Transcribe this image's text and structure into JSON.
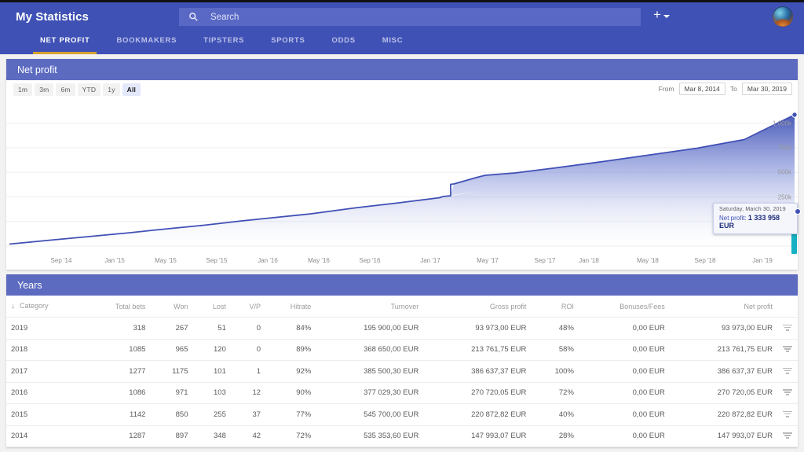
{
  "header": {
    "app_title": "My Statistics",
    "search_placeholder": "Search",
    "search_icon": "search-icon",
    "add_icon": "plus-icon",
    "avatar_icon": "user-avatar"
  },
  "tabs": [
    {
      "label": "NET PROFIT",
      "active": true
    },
    {
      "label": "BOOKMAKERS",
      "active": false
    },
    {
      "label": "TIPSTERS",
      "active": false
    },
    {
      "label": "SPORTS",
      "active": false
    },
    {
      "label": "ODDS",
      "active": false
    },
    {
      "label": "MISC",
      "active": false
    }
  ],
  "chart_panel": {
    "title": "Net profit",
    "ranges": [
      {
        "label": "1m",
        "active": false
      },
      {
        "label": "3m",
        "active": false
      },
      {
        "label": "6m",
        "active": false
      },
      {
        "label": "YTD",
        "active": false
      },
      {
        "label": "1y",
        "active": false
      },
      {
        "label": "All",
        "active": true
      }
    ],
    "from_label": "From",
    "from_value": "Mar 8, 2014",
    "to_label": "To",
    "to_value": "Mar 30, 2019",
    "tooltip": {
      "date": "Saturday, March 30, 2019",
      "label": "Net profit:",
      "value": "1 333 958 EUR"
    }
  },
  "chart_data": {
    "type": "area",
    "title": "Net profit",
    "xlabel": "",
    "ylabel": "",
    "ylim": [
      0,
      1400000
    ],
    "yticks": [
      0,
      250000,
      500000,
      750000,
      1000000
    ],
    "ytick_labels": [
      "0",
      "250k",
      "500k",
      "750k",
      "1 000k"
    ],
    "grid": true,
    "legend": "none",
    "line_color": "#4050b5",
    "fill_gradient": [
      "#4050b5",
      "#ffffff"
    ],
    "xtick_labels": [
      "Sep '14",
      "Jan '15",
      "May '15",
      "Sep '15",
      "Jan '16",
      "May '16",
      "Sep '16",
      "Jan '17",
      "May '17",
      "Sep '17",
      "Jan '18",
      "May '18",
      "Sep '18",
      "Jan '19"
    ],
    "x": [
      "2014-03",
      "2014-06",
      "2014-09",
      "2014-12",
      "2015-01",
      "2015-03",
      "2015-05",
      "2015-08",
      "2015-11",
      "2016-01",
      "2016-04",
      "2016-07",
      "2016-10",
      "2017-01",
      "2017-03",
      "2017-04",
      "2017-05",
      "2017-06",
      "2017-09",
      "2017-12",
      "2018-03",
      "2018-06",
      "2018-09",
      "2018-12",
      "2019-03"
    ],
    "y": [
      20000,
      60000,
      110000,
      150000,
      175000,
      200000,
      230000,
      270000,
      305000,
      340000,
      400000,
      450000,
      500000,
      560000,
      578000,
      700000,
      770000,
      800000,
      855000,
      910000,
      985000,
      1060000,
      1130000,
      1230000,
      1333958
    ],
    "annotations": [
      {
        "x": "2019-03-30",
        "y": 1333958,
        "text": "Saturday, March 30, 2019 / Net profit: 1 333 958 EUR"
      }
    ]
  },
  "table_panel": {
    "title": "Years",
    "sort_icon": "sort-down-arrow-icon",
    "columns": [
      "Category",
      "Total bets",
      "Won",
      "Lost",
      "V/P",
      "Hitrate",
      "Turnover",
      "Gross profit",
      "ROI",
      "Bonuses/Fees",
      "Net profit"
    ],
    "rows": [
      {
        "category": "2019",
        "total_bets": "318",
        "won": "267",
        "lost": "51",
        "vp": "0",
        "hitrate": "84%",
        "turnover": "195 900,00 EUR",
        "gross_profit": "93 973,00 EUR",
        "roi": "48%",
        "bonuses_fees": "0,00 EUR",
        "net_profit": "93 973,00 EUR"
      },
      {
        "category": "2018",
        "total_bets": "1085",
        "won": "965",
        "lost": "120",
        "vp": "0",
        "hitrate": "89%",
        "turnover": "368 650,00 EUR",
        "gross_profit": "213 761,75 EUR",
        "roi": "58%",
        "bonuses_fees": "0,00 EUR",
        "net_profit": "213 761,75 EUR"
      },
      {
        "category": "2017",
        "total_bets": "1277",
        "won": "1175",
        "lost": "101",
        "vp": "1",
        "hitrate": "92%",
        "turnover": "385 500,30 EUR",
        "gross_profit": "386 637,37 EUR",
        "roi": "100%",
        "bonuses_fees": "0,00 EUR",
        "net_profit": "386 637,37 EUR"
      },
      {
        "category": "2016",
        "total_bets": "1086",
        "won": "971",
        "lost": "103",
        "vp": "12",
        "hitrate": "90%",
        "turnover": "377 029,30 EUR",
        "gross_profit": "270 720,05 EUR",
        "roi": "72%",
        "bonuses_fees": "0,00 EUR",
        "net_profit": "270 720,05 EUR"
      },
      {
        "category": "2015",
        "total_bets": "1142",
        "won": "850",
        "lost": "255",
        "vp": "37",
        "hitrate": "77%",
        "turnover": "545 700,00 EUR",
        "gross_profit": "220 872,82 EUR",
        "roi": "40%",
        "bonuses_fees": "0,00 EUR",
        "net_profit": "220 872,82 EUR"
      },
      {
        "category": "2014",
        "total_bets": "1287",
        "won": "897",
        "lost": "348",
        "vp": "42",
        "hitrate": "72%",
        "turnover": "535 353,60 EUR",
        "gross_profit": "147 993,07 EUR",
        "roi": "28%",
        "bonuses_fees": "0,00 EUR",
        "net_profit": "147 993,07 EUR"
      }
    ],
    "filter_icon": "filter-icon"
  },
  "colors": {
    "brand": "#3f51b5",
    "panel_head": "#5c6bc0",
    "accent_underline": "#d6a42e",
    "link": "#5061c4",
    "scrollbar": "#16b0c4"
  }
}
